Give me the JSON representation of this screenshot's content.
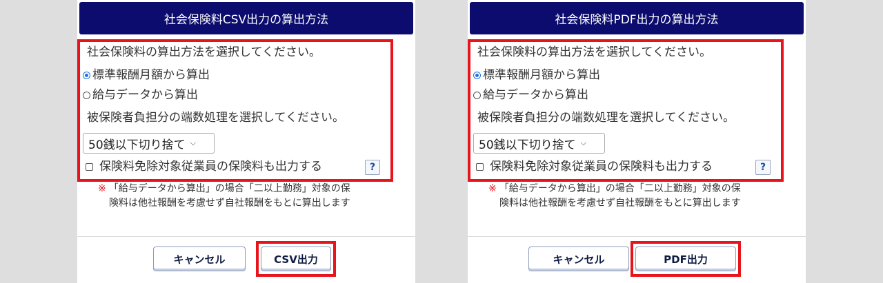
{
  "dialogs": [
    {
      "title": "社会保険料CSV出力の算出方法",
      "prompt_method": "社会保険料の算出方法を選択してください。",
      "radio_options": [
        {
          "label": "標準報酬月額から算出",
          "checked": true
        },
        {
          "label": "給与データから算出",
          "checked": false
        }
      ],
      "prompt_rounding": "被保険者負担分の端数処理を選択してください。",
      "rounding_select": "50銭以下切り捨て",
      "checkbox_label": "保険料免除対象従業員の保険料も出力する",
      "help_label": "?",
      "note_mark": "※",
      "note_line1": "「給与データから算出」の場合「二以上勤務」対象の保",
      "note_line2": "険料は他社報酬を考慮せず自社報酬をもとに算出します",
      "cancel_label": "キャンセル",
      "export_label": "CSV出力"
    },
    {
      "title": "社会保険料PDF出力の算出方法",
      "prompt_method": "社会保険料の算出方法を選択してください。",
      "radio_options": [
        {
          "label": "標準報酬月額から算出",
          "checked": true
        },
        {
          "label": "給与データから算出",
          "checked": false
        }
      ],
      "prompt_rounding": "被保険者負担分の端数処理を選択してください。",
      "rounding_select": "50銭以下切り捨て",
      "checkbox_label": "保険料免除対象従業員の保険料も出力する",
      "help_label": "?",
      "note_mark": "※",
      "note_line1": "「給与データから算出」の場合「二以上勤務」対象の保",
      "note_line2": "険料は他社報酬を考慮せず自社報酬をもとに算出します",
      "cancel_label": "キャンセル",
      "export_label": "PDF出力"
    }
  ],
  "colors": {
    "header_bg": "#0c0c6e",
    "highlight": "#e8141c",
    "radio_checked": "#1f6fe0"
  }
}
